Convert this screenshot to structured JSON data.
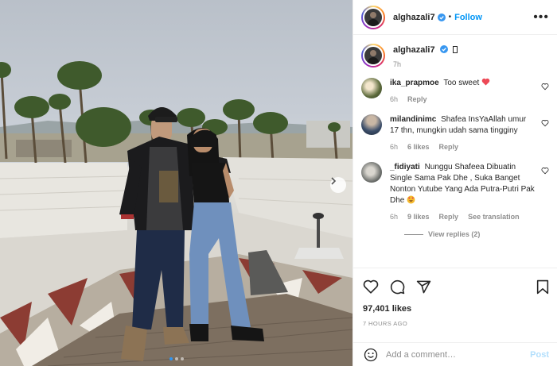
{
  "post": {
    "username": "alghazali7",
    "follow_label": "Follow",
    "separator": "•",
    "more_label": "•••",
    "caption_time": "7h",
    "likes": "97,401 likes",
    "posted_ago": "7 HOURS AGO",
    "image_count": 3,
    "active_image": 1
  },
  "comments": [
    {
      "username": "ika_prapmoe",
      "text": "Too sweet",
      "time": "6h",
      "likes": "",
      "reply_label": "Reply",
      "extra": ""
    },
    {
      "username": "milandinimc",
      "text": "Shafea InsYaAllah umur 17 thn, mungkin udah sama tingginy",
      "time": "6h",
      "likes": "6 likes",
      "reply_label": "Reply",
      "extra": ""
    },
    {
      "username": "_fidiyati",
      "text": "Nunggu Shafeea Dibuatin Single Sama Pak Dhe , Suka Banget Nonton Yutube Yang Ada Putra-Putri Pak Dhe",
      "time": "6h",
      "likes": "9 likes",
      "reply_label": "Reply",
      "extra": "See translation"
    }
  ],
  "view_replies": "View replies (2)",
  "add_comment": {
    "placeholder": "Add a comment…",
    "post_label": "Post"
  },
  "icons": {
    "verified": "verified-badge-icon",
    "like": "heart-icon",
    "comment": "comment-bubble-icon",
    "share": "paper-plane-icon",
    "save": "bookmark-icon",
    "emoji": "smiley-icon",
    "next": "chevron-right-icon"
  },
  "colors": {
    "accent": "#0095f6",
    "verified": "#3897f0",
    "heart": "#ed4956"
  }
}
